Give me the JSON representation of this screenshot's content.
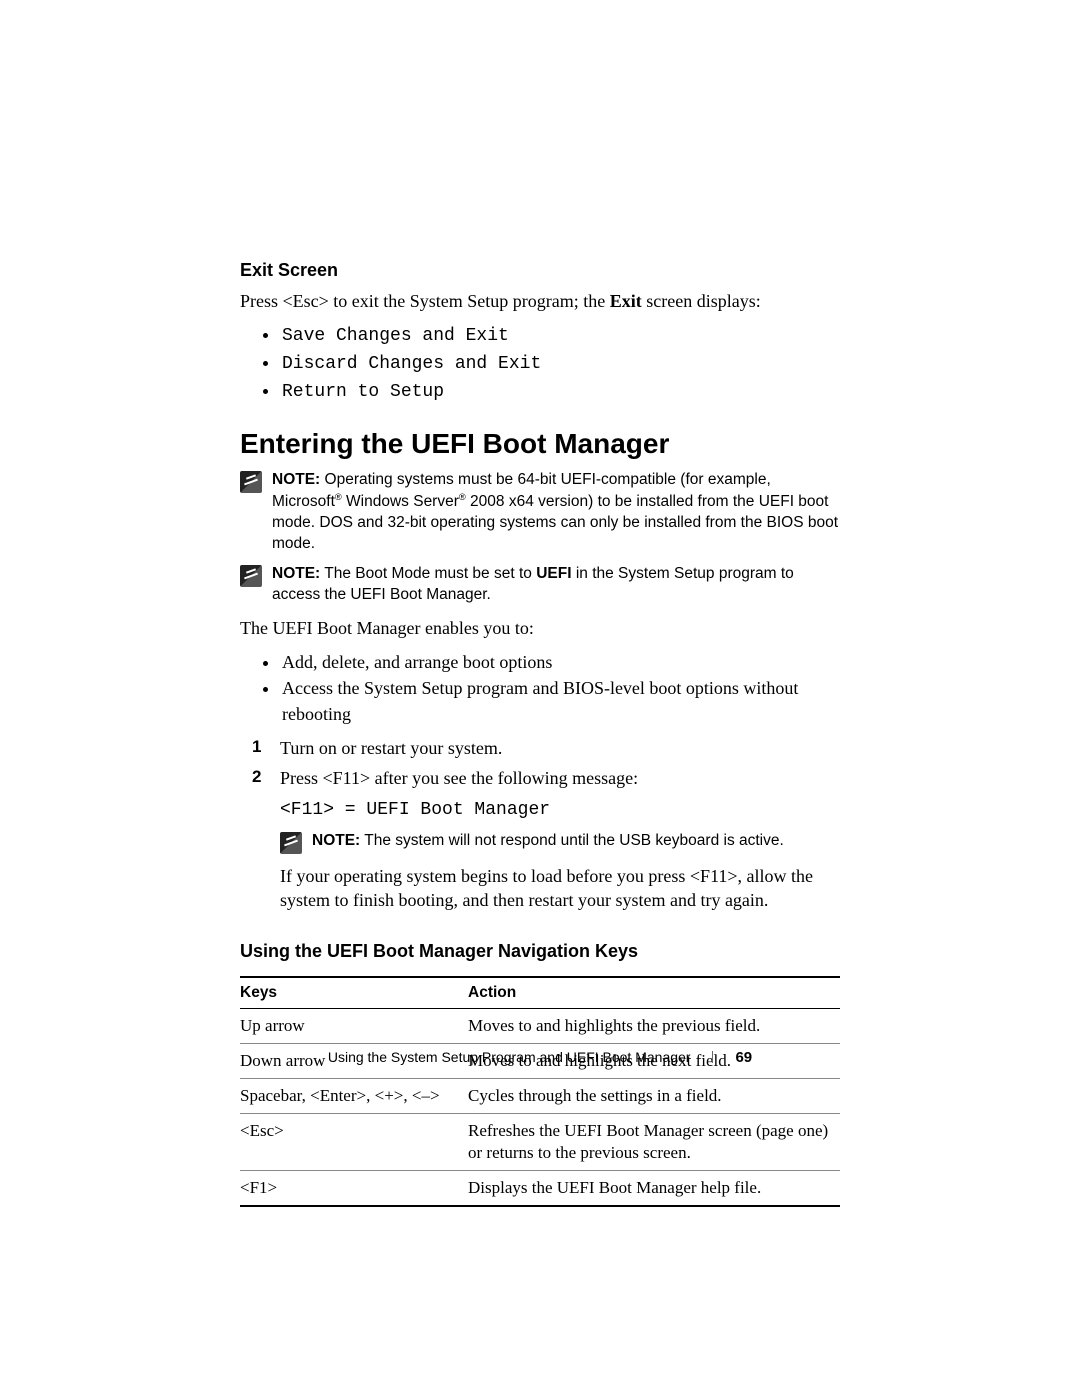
{
  "exit": {
    "heading": "Exit Screen",
    "intro_before": "Press <Esc> to exit the System Setup program; the ",
    "intro_bold": "Exit",
    "intro_after": " screen displays:",
    "items": [
      "Save Changes and Exit",
      "Discard Changes and Exit",
      "Return to Setup"
    ]
  },
  "section": {
    "title": "Entering the UEFI Boot Manager",
    "note1": {
      "label": "NOTE:",
      "text_a": " Operating systems must be 64-bit UEFI-compatible (for example, Microsoft",
      "text_b": " Windows Server",
      "text_c": " 2008 x64 version) to be installed from the UEFI boot mode. DOS and 32-bit operating systems can only be installed from the BIOS boot mode."
    },
    "note2": {
      "label": "NOTE:",
      "text_a": " The Boot Mode must be set to ",
      "bold": "UEFI",
      "text_b": " in the System Setup program to access the UEFI Boot Manager."
    },
    "enables_intro": "The UEFI Boot Manager enables you to:",
    "enables": [
      "Add, delete, and arrange boot options",
      "Access the System Setup program and BIOS-level boot options without rebooting"
    ],
    "steps": {
      "s1": "Turn on or restart your system.",
      "s2": "Press <F11> after you see the following message:",
      "s2_code": "<F11> = UEFI Boot Manager",
      "s2_note_label": "NOTE:",
      "s2_note_text": " The system will not respond until the USB keyboard is active.",
      "s2_after": "If your operating system begins to load before you press <F11>, allow the system to finish booting, and then restart your system and try again."
    }
  },
  "nav": {
    "heading": "Using the UEFI Boot Manager Navigation Keys",
    "col1": "Keys",
    "col2": "Action",
    "rows": [
      {
        "k": "Up arrow",
        "a": "Moves to and highlights the previous field."
      },
      {
        "k": "Down arrow",
        "a": "Moves to and highlights the next field."
      },
      {
        "k": "Spacebar, <Enter>, <+>, <–>",
        "a": "Cycles through the settings in a field."
      },
      {
        "k": "<Esc>",
        "a": "Refreshes the UEFI Boot Manager screen (page one) or returns to the previous screen."
      },
      {
        "k": "<F1>",
        "a": "Displays the UEFI Boot Manager help file."
      }
    ]
  },
  "footer": {
    "text": "Using the System Setup Program and UEFI Boot Manager",
    "page": "69"
  }
}
